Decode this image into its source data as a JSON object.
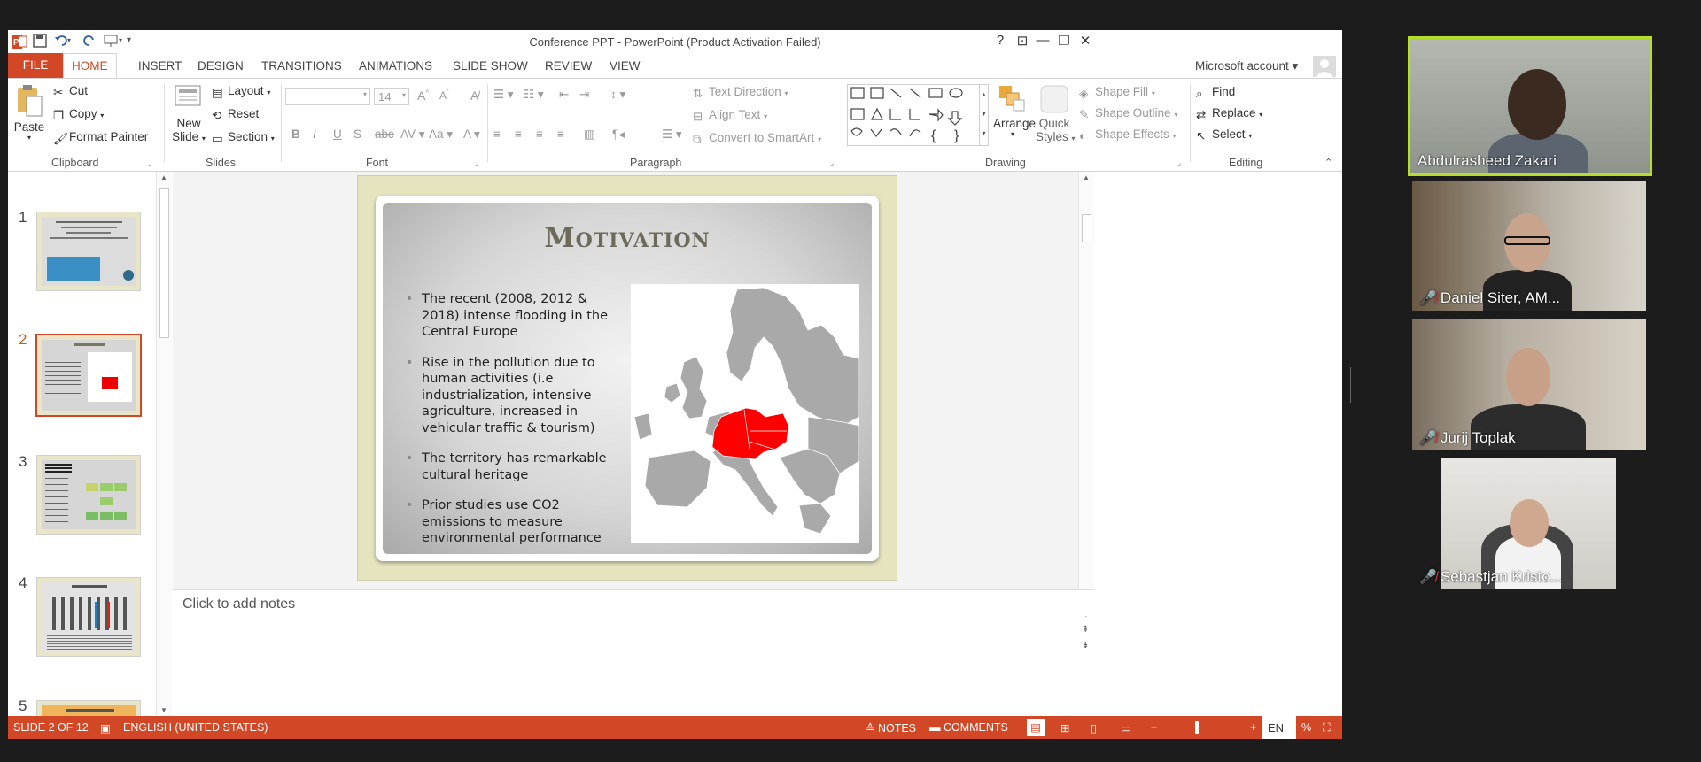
{
  "window": {
    "title": "Conference PPT - PowerPoint (Product Activation Failed)",
    "controls": [
      "?",
      "⊡",
      "—",
      "❐",
      "✕"
    ]
  },
  "tabs": {
    "file": "FILE",
    "home": "HOME",
    "insert": "INSERT",
    "design": "DESIGN",
    "transitions": "TRANSITIONS",
    "animations": "ANIMATIONS",
    "slide_show": "SLIDE SHOW",
    "review": "REVIEW",
    "view": "VIEW",
    "account": "Microsoft account"
  },
  "ribbon": {
    "clipboard": {
      "paste": "Paste",
      "cut": "Cut",
      "copy": "Copy",
      "format_painter": "Format Painter",
      "label": "Clipboard"
    },
    "slides": {
      "new_slide_1": "New",
      "new_slide_2": "Slide",
      "layout": "Layout",
      "reset": "Reset",
      "section": "Section",
      "label": "Slides"
    },
    "font": {
      "size": "14",
      "bold": "B",
      "italic": "I",
      "underline": "U",
      "strike": "S",
      "label": "Font"
    },
    "paragraph": {
      "text_direction": "Text Direction",
      "align_text": "Align Text",
      "convert_smartart": "Convert to SmartArt",
      "label": "Paragraph"
    },
    "drawing": {
      "arrange": "Arrange",
      "quick_styles_1": "Quick",
      "quick_styles_2": "Styles",
      "shape_fill": "Shape Fill",
      "shape_outline": "Shape Outline",
      "shape_effects": "Shape Effects",
      "label": "Drawing"
    },
    "editing": {
      "find": "Find",
      "replace": "Replace",
      "select": "Select",
      "label": "Editing"
    }
  },
  "thumbnails": [
    "1",
    "2",
    "3",
    "4",
    "5"
  ],
  "slide": {
    "title": "Motivation",
    "bullets": [
      "The recent (2008, 2012 & 2018) intense flooding in the Central Europe",
      "Rise in the pollution due to human activities (i.e industrialization, intensive agriculture, increased in vehicular traffic & tourism)",
      "The territory has remarkable cultural heritage",
      "Prior studies use CO2 emissions to measure environmental performance"
    ]
  },
  "notes": {
    "placeholder": "Click to add notes"
  },
  "status": {
    "slide": "SLIDE 2 OF 12",
    "language": "ENGLISH (UNITED STATES)",
    "notes": "NOTES",
    "comments": "COMMENTS",
    "lang_code": "EN"
  },
  "participants": [
    {
      "name": "Abdulrasheed Zakari",
      "active": true,
      "muted": false
    },
    {
      "name": "Daniel Siter, AM...",
      "active": false,
      "muted": true
    },
    {
      "name": "Jurij Toplak",
      "active": false,
      "muted": true
    },
    {
      "name": "Sebastjan Kristo...",
      "active": false,
      "muted": true
    }
  ],
  "colors": {
    "accent": "#d24726",
    "speaker_border": "#b6dd2a",
    "map_highlight": "#ff0000"
  }
}
